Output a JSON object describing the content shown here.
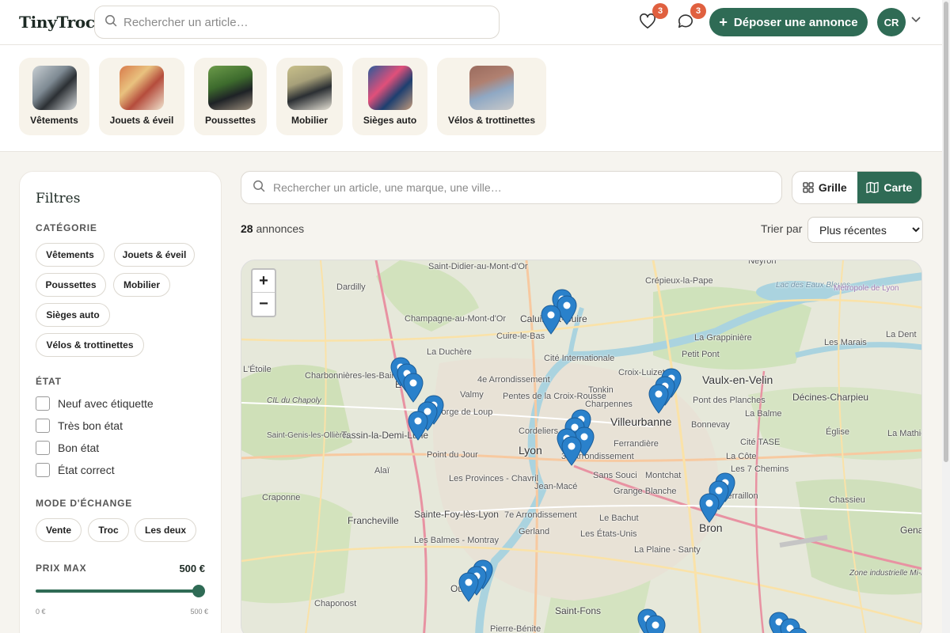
{
  "header": {
    "logo": "TinyTroc",
    "search_placeholder": "Rechercher un article…",
    "favorites_count": "3",
    "messages_count": "3",
    "post_button": "Déposer une annonce",
    "avatar_initials": "CR"
  },
  "categories": [
    {
      "label": "Vêtements"
    },
    {
      "label": "Jouets & éveil"
    },
    {
      "label": "Poussettes"
    },
    {
      "label": "Mobilier"
    },
    {
      "label": "Sièges auto"
    },
    {
      "label": "Vélos & trottinettes"
    }
  ],
  "filters": {
    "title": "Filtres",
    "category_label": "CATÉGORIE",
    "category_chips": [
      "Vêtements",
      "Jouets & éveil",
      "Poussettes",
      "Mobilier",
      "Sièges auto",
      "Vélos & trottinettes"
    ],
    "condition_label": "ÉTAT",
    "conditions": [
      "Neuf avec étiquette",
      "Très bon état",
      "Bon état",
      "État correct"
    ],
    "exchange_label": "MODE D'ÉCHANGE",
    "exchange_chips": [
      "Vente",
      "Troc",
      "Les deux"
    ],
    "price_label": "PRIX MAX",
    "price_value": "500 €",
    "price_min": "0 €",
    "price_max": "500 €"
  },
  "main": {
    "search_placeholder": "Rechercher un article, une marque, une ville…",
    "view_grid": "Grille",
    "view_map": "Carte",
    "count_number": "28",
    "count_label": "annonces",
    "sort_label": "Trier par",
    "sort_selected": "Plus récentes"
  },
  "map": {
    "zoom_in": "+",
    "zoom_out": "−",
    "places": [
      "Saint-Didier-au-Mont-d'Or",
      "Caluire-et-Cuire",
      "Cuire-le-Bas",
      "Crépieux-la-Pape",
      "Neyron",
      "Lac des Eaux Bleues",
      "Métropole de Lyon",
      "Dardilly",
      "Champagne-au-Mont-d'Or",
      "La Duchère",
      "La Grappinière",
      "Petit Pont",
      "Les Marais",
      "La Dent",
      "Cité Internationale",
      "Charbonnières-les-Bains",
      "Écully",
      "4e Arrondissement",
      "Croix-Luizet",
      "Vaulx-en-Velin",
      "Tonkin",
      "Pentes de la Croix-Rousse",
      "Charpennes",
      "Pont des Planches",
      "Décines-Charpieu",
      "Valmy",
      "Gorge de Loup",
      "Villeurbanne",
      "La Balme",
      "Bonnevay",
      "Tassin-la-Demi-Lune",
      "Cordeliers",
      "Saint-Genis-les-Ollières",
      "Lyon",
      "3e Arrondissement",
      "Ferrandière",
      "Cité TASE",
      "Église",
      "La Mathiolaz",
      "Point du Jour",
      "Alaï",
      "Les Provinces - Chavril",
      "Sans Souci",
      "Montchat",
      "La Côte",
      "Les 7 Chemins",
      "Craponne",
      "Jean-Macé",
      "Grange Blanche",
      "Terraillon",
      "Chassieu",
      "Francheville",
      "Sainte-Foy-lès-Lyon",
      "7e Arrondissement",
      "Le Bachut",
      "Bron",
      "Gerland",
      "Les États-Unis",
      "Les Balmes - Montray",
      "La Plaine - Santy",
      "Zone industrielle Mi-Plaine",
      "Chaponost",
      "Oullins",
      "Saint-Fons",
      "Pierre-Bénite",
      "L'Étoile",
      "CIL du Chapoly",
      "Genas"
    ]
  }
}
